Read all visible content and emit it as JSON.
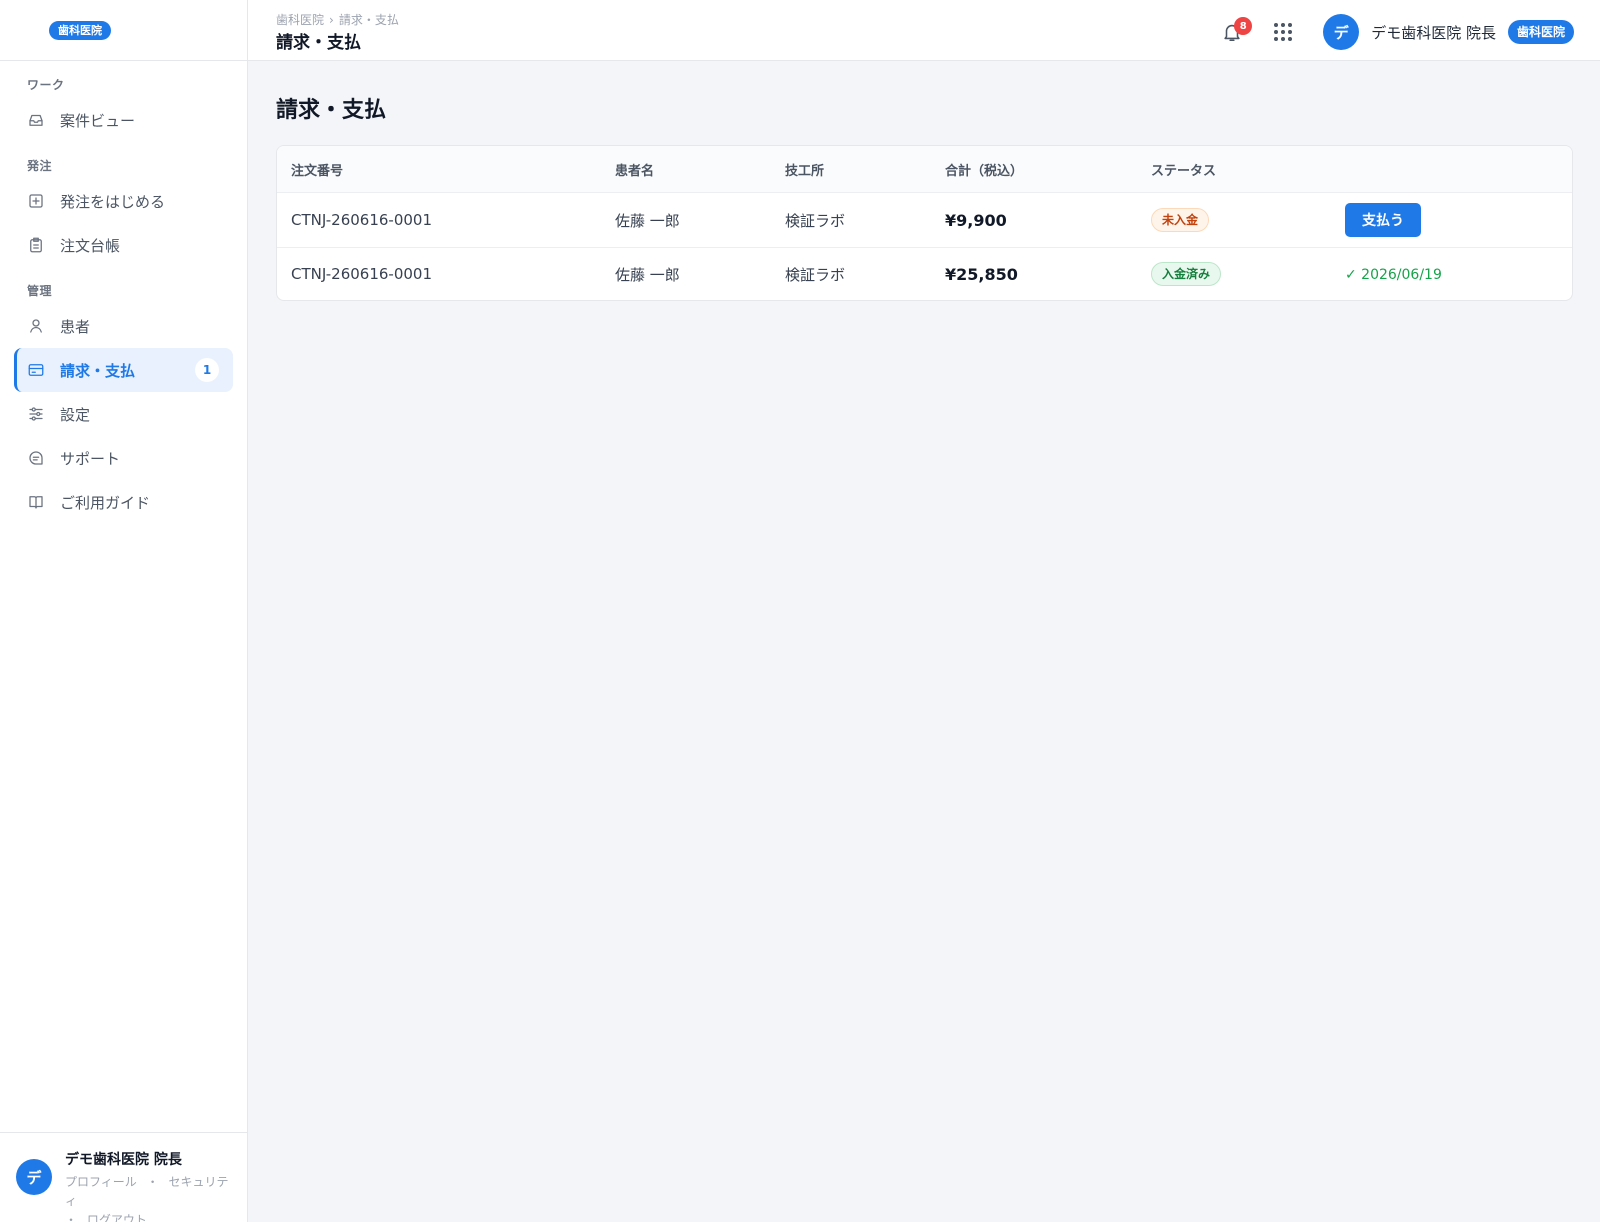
{
  "brand": {
    "badge": "歯科医院"
  },
  "sidebar": {
    "sections": [
      {
        "label": "ワーク"
      },
      {
        "label": "発注"
      },
      {
        "label": "管理"
      }
    ],
    "items": [
      {
        "label": "案件ビュー",
        "icon": "inbox-icon"
      },
      {
        "label": "発注をはじめる",
        "icon": "plus-square-icon"
      },
      {
        "label": "注文台帳",
        "icon": "clipboard-icon"
      },
      {
        "label": "患者",
        "icon": "user-icon"
      },
      {
        "label": "請求・支払",
        "icon": "credit-card-icon",
        "active": true,
        "badge": "1"
      },
      {
        "label": "設定",
        "icon": "sliders-icon"
      },
      {
        "label": "サポート",
        "icon": "chat-icon"
      },
      {
        "label": "ご利用ガイド",
        "icon": "book-icon"
      }
    ],
    "footer": {
      "avatar_initial": "デ",
      "name": "デモ歯科医院 院長",
      "links": {
        "profile": "プロフィール",
        "security": "セキュリティ",
        "logout": "ログアウト",
        "separator": "・"
      }
    }
  },
  "header": {
    "breadcrumb": [
      "歯科医院",
      "請求・支払"
    ],
    "breadcrumb_separator": "›",
    "title": "請求・支払",
    "notifications_count": "8",
    "user": {
      "avatar_initial": "デ",
      "name": "デモ歯科医院 院長",
      "role_badge": "歯科医院"
    }
  },
  "main": {
    "title": "請求・支払",
    "table": {
      "headers": [
        "注文番号",
        "患者名",
        "技工所",
        "合計（税込）",
        "ステータス",
        ""
      ],
      "rows": [
        {
          "order_no": "CTNJ-260616-0001",
          "patient": "佐藤 一郎",
          "lab": "検証ラボ",
          "total": "¥9,900",
          "status": "未入金",
          "action_label": "支払う"
        },
        {
          "order_no": "CTNJ-260616-0001",
          "patient": "佐藤 一郎",
          "lab": "検証ラボ",
          "total": "¥25,850",
          "status": "入金済み",
          "paid_date": "✓ 2026/06/19"
        }
      ]
    }
  },
  "colors": {
    "accent": "#1f7ae8",
    "unpaid": "#c2410c",
    "paid": "#15803d",
    "notification": "#ef4444"
  }
}
